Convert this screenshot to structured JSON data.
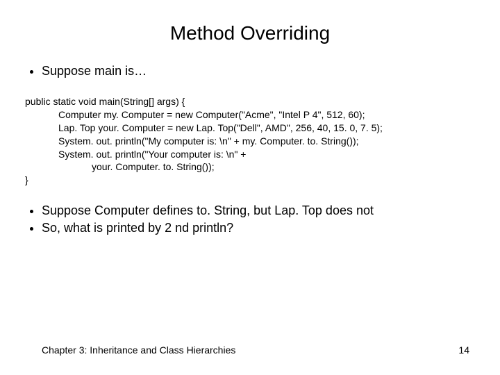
{
  "title": "Method Overriding",
  "bullets_top": [
    "Suppose main is…"
  ],
  "code": {
    "l0": "public static void main(String[] args) {",
    "l1": "Computer my. Computer = new Computer(\"Acme\", \"Intel P 4\", 512, 60);",
    "l2": "Lap. Top your. Computer = new Lap. Top(\"Dell\", AMD\", 256, 40, 15. 0, 7. 5);",
    "l3": "System. out. println(\"My computer is: \\n\" + my. Computer. to. String());",
    "l4": "System. out. println(\"Your computer is: \\n\" +",
    "l5": "your. Computer. to. String());",
    "l6": "}"
  },
  "bullets_bottom": [
    "Suppose Computer defines to. String, but Lap. Top does not",
    "So, what is printed by 2 nd println?"
  ],
  "footer": {
    "chapter": "Chapter 3: Inheritance and Class Hierarchies",
    "page": "14"
  }
}
